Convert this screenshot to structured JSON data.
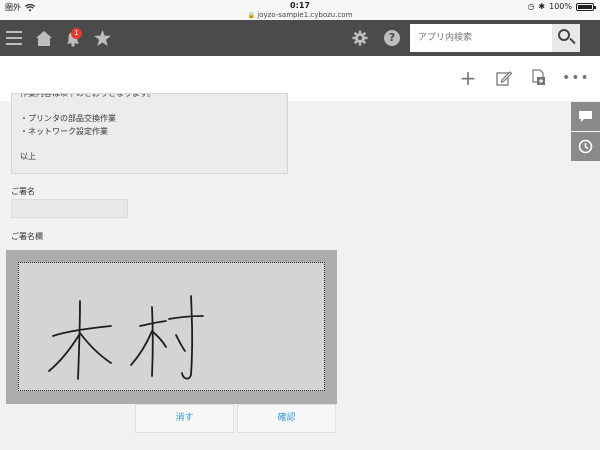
{
  "status_bar": {
    "carrier": "圏外",
    "time": "0:17",
    "url": "joyzo-sample1.cybozu.com",
    "battery": "100%",
    "battery_level": 1.0
  },
  "header": {
    "menu_icon": "hamburger-menu-icon",
    "home_icon": "home-icon",
    "notification_icon": "bell-icon",
    "notification_count": "1",
    "favorites_icon": "star-icon",
    "settings_icon": "gear-icon",
    "help_icon": "help-icon",
    "search_placeholder": "アプリ内検索",
    "search_icon": "search-icon"
  },
  "toolbar": {
    "add_icon": "plus-icon",
    "edit_icon": "edit-icon",
    "duplicate_icon": "duplicate-icon",
    "more_icon": "more-icon"
  },
  "side_buttons": {
    "comment_icon": "comment-icon",
    "history_icon": "history-icon"
  },
  "content": {
    "text_lines": [
      "作業内容は以下のとおりとなります。",
      "",
      "・プリンタの部品交換作業",
      "・ネットワーク設定作業",
      "",
      "以上"
    ],
    "signature_name_label": "ご署名",
    "signature_name_value": "",
    "signature_area_label": "ご署名欄"
  },
  "buttons": {
    "clear_label": "消す",
    "confirm_label": "確認"
  },
  "colors": {
    "header_bg": "#4b4b4b",
    "badge": "#e63b2e",
    "button_text": "#3498db"
  }
}
